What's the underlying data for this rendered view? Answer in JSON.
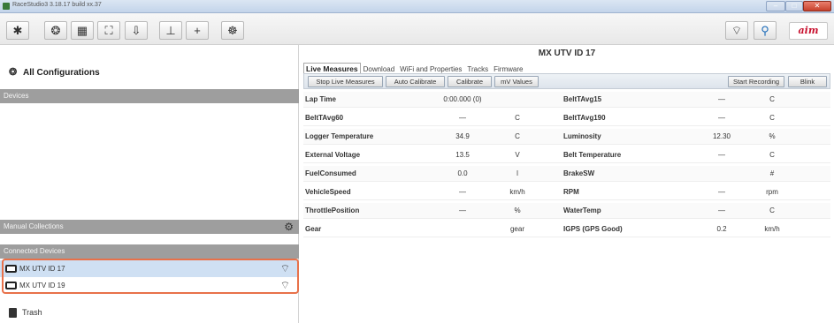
{
  "window": {
    "title": "RaceStudio3 3.18.17 build xx.37"
  },
  "toolbar": {
    "buttons": [
      {
        "icon": "asterisk-icon",
        "glyph": "✱"
      },
      {
        "icon": "configurations-icon",
        "glyph": "❂"
      },
      {
        "icon": "grid-icon",
        "glyph": "▦"
      },
      {
        "icon": "track-icon",
        "glyph": "⛶"
      },
      {
        "icon": "download-icon",
        "glyph": "⇩"
      },
      {
        "icon": "chart-icon",
        "glyph": "⊥"
      },
      {
        "icon": "add-device-icon",
        "glyph": "+"
      },
      {
        "icon": "settings-icon",
        "glyph": "☸"
      }
    ],
    "logo": "aim"
  },
  "sidebar": {
    "all_configurations": "All Configurations",
    "devices_header": "Devices",
    "manual_collections": "Manual Collections",
    "connected_devices": "Connected Devices",
    "devices": [
      {
        "name": "MX UTV ID 17",
        "selected": true
      },
      {
        "name": "MX UTV ID 19",
        "selected": false
      }
    ],
    "trash": "Trash"
  },
  "main": {
    "title": "MX UTV ID 17",
    "tabs": [
      "Live Measures",
      "Download",
      "WiFi and Properties",
      "Tracks",
      "Firmware"
    ],
    "actions": {
      "stop_live": "Stop Live Measures",
      "auto_calibrate": "Auto Calibrate",
      "calibrate": "Calibrate",
      "mv_values": "mV Values",
      "start_recording": "Start Recording",
      "blink": "Blink"
    },
    "rows": [
      {
        "l": [
          "Lap Time",
          "0:00.000 (0)",
          ""
        ],
        "r": [
          "BeltTAvg15",
          "—",
          "C"
        ]
      },
      {
        "l": [
          "BeltTAvg60",
          "—",
          "C"
        ],
        "r": [
          "BeltTAvg190",
          "—",
          "C"
        ]
      },
      {
        "l": [
          "Logger Temperature",
          "34.9",
          "C"
        ],
        "r": [
          "Luminosity",
          "12.30",
          "%"
        ]
      },
      {
        "l": [
          "External Voltage",
          "13.5",
          "V"
        ],
        "r": [
          "Belt Temperature",
          "—",
          "C"
        ]
      },
      {
        "l": [
          "FuelConsumed",
          "0.0",
          "l"
        ],
        "r": [
          "BrakeSW",
          "",
          "#"
        ]
      },
      {
        "l": [
          "VehicleSpeed",
          "—",
          "km/h"
        ],
        "r": [
          "RPM",
          "—",
          "rpm"
        ]
      },
      {
        "l": [
          "ThrottlePosition",
          "—",
          "%"
        ],
        "r": [
          "WaterTemp",
          "—",
          "C"
        ]
      },
      {
        "l": [
          "Gear",
          "",
          "gear"
        ],
        "r": [
          "IGPS (GPS Good)",
          "0.2",
          "km/h"
        ]
      }
    ]
  }
}
